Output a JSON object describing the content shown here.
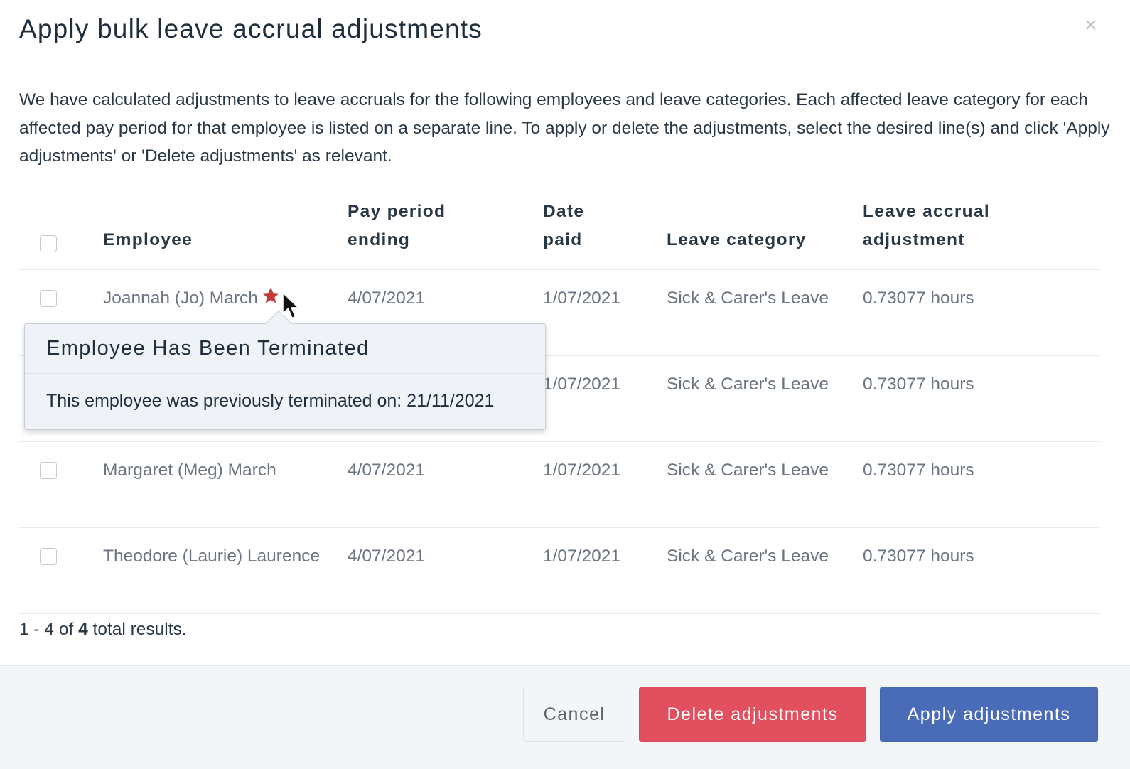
{
  "modal": {
    "title": "Apply bulk leave accrual adjustments",
    "close_symbol": "×",
    "intro": "We have calculated adjustments to leave accruals for the following employees and leave categories. Each affected leave category for each affected pay period for that employee is listed on a separate line. To apply or delete the adjustments, select the desired line(s) and click 'Apply adjustments' or 'Delete adjustments' as relevant."
  },
  "table": {
    "headers": {
      "employee": "Employee",
      "pay_period_line1": "Pay period",
      "pay_period_line2": "ending",
      "date_paid_line1": "Date",
      "date_paid_line2": "paid",
      "leave_category": "Leave category",
      "adjustment_line1": "Leave accrual",
      "adjustment_line2": "adjustment"
    },
    "rows": [
      {
        "employee": "Joannah (Jo) March",
        "terminated": true,
        "pay_period_ending": "4/07/2021",
        "date_paid": "1/07/2021",
        "leave_category": "Sick & Carer's Leave",
        "adjustment": "0.73077 hours"
      },
      {
        "employee": "",
        "terminated": false,
        "pay_period_ending": "",
        "date_paid": "1/07/2021",
        "leave_category": "Sick & Carer's Leave",
        "adjustment": "0.73077 hours"
      },
      {
        "employee": "Margaret (Meg) March",
        "terminated": false,
        "pay_period_ending": "4/07/2021",
        "date_paid": "1/07/2021",
        "leave_category": "Sick & Carer's Leave",
        "adjustment": "0.73077 hours"
      },
      {
        "employee": "Theodore (Laurie) Laurence",
        "terminated": false,
        "pay_period_ending": "4/07/2021",
        "date_paid": "1/07/2021",
        "leave_category": "Sick & Carer's Leave",
        "adjustment": "0.73077 hours"
      }
    ],
    "results": {
      "prefix": "1 - 4 of",
      "total": "4",
      "suffix": "total results."
    }
  },
  "tooltip": {
    "title": "Employee Has Been Terminated",
    "body": "This employee was previously terminated on: 21/11/2021",
    "icon": "star-icon"
  },
  "footer": {
    "cancel_label": "Cancel",
    "delete_label": "Delete adjustments",
    "apply_label": "Apply adjustments"
  },
  "colors": {
    "delete": "#e2505f",
    "apply": "#4a6cb8",
    "terminated_star": "#c0393b"
  }
}
